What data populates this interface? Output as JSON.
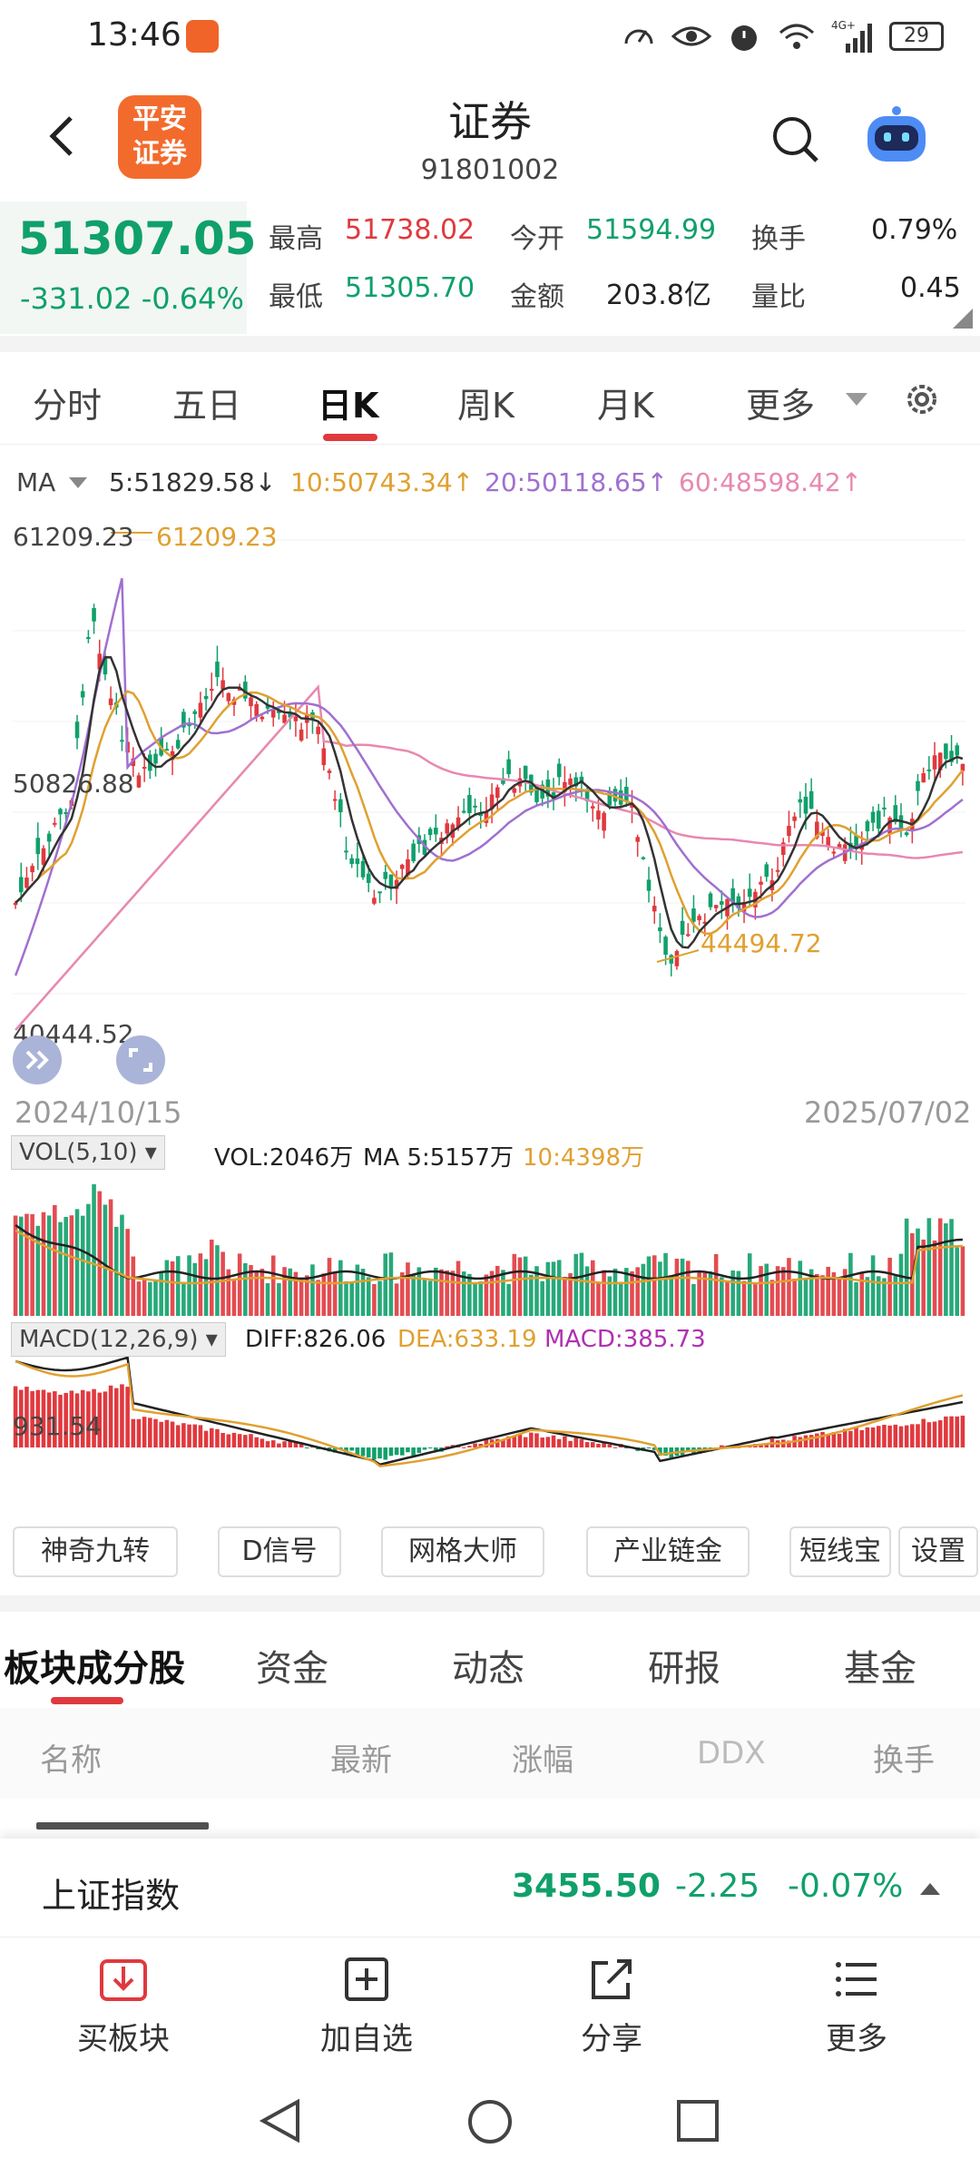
{
  "status_bar": {
    "time": "13:46",
    "battery": "29",
    "network": "4G+"
  },
  "header": {
    "brand_line1": "平安",
    "brand_line2": "证券",
    "title": "证券",
    "code": "91801002"
  },
  "quote": {
    "price": "51307.05",
    "change": "-331.02",
    "change_pct": "-0.64%",
    "high_label": "最高",
    "high": "51738.02",
    "low_label": "最低",
    "low": "51305.70",
    "open_label": "今开",
    "open": "51594.99",
    "amount_label": "金额",
    "amount": "203.8亿",
    "turnover_label": "换手",
    "turnover": "0.79%",
    "volume_ratio_label": "量比",
    "volume_ratio": "0.45"
  },
  "period_tabs": [
    {
      "label": "分时"
    },
    {
      "label": "五日"
    },
    {
      "label": "日K"
    },
    {
      "label": "周K"
    },
    {
      "label": "月K"
    },
    {
      "label": "更多"
    }
  ],
  "ma_legend": {
    "label": "MA",
    "items": [
      {
        "text": "5:51829.58↓",
        "color": "#333333"
      },
      {
        "text": "10:50743.34↑",
        "color": "#e0a030"
      },
      {
        "text": "20:50118.65↑",
        "color": "#a070d0"
      },
      {
        "text": "60:48598.42↑",
        "color": "#e888b0"
      }
    ]
  },
  "kline_labels": {
    "max_axis": "61209.23",
    "max_point": "61209.23",
    "mid_axis": "50826.88",
    "min_point": "44494.72",
    "min_axis": "40444.52",
    "start_date": "2024/10/15",
    "end_date": "2025/07/02"
  },
  "vol_legend": {
    "selector": "VOL(5,10)",
    "vol": "VOL:2046万",
    "ma5": "MA 5:5157万",
    "ma10": "10:4398万"
  },
  "macd_legend": {
    "selector": "MACD(12,26,9)",
    "diff": "DIFF:826.06",
    "dea": "DEA:633.19",
    "macd": "MACD:385.73",
    "axis": "931.54"
  },
  "tool_buttons": [
    {
      "label": "神奇九转"
    },
    {
      "label": "D信号"
    },
    {
      "label": "网格大师"
    },
    {
      "label": "产业链金"
    },
    {
      "label": "短线宝"
    },
    {
      "label": "设置"
    }
  ],
  "sub_tabs": [
    {
      "label": "板块成分股"
    },
    {
      "label": "资金"
    },
    {
      "label": "动态"
    },
    {
      "label": "研报"
    },
    {
      "label": "基金"
    }
  ],
  "table_header": {
    "name": "名称",
    "latest": "最新",
    "change": "涨幅",
    "ddx": "DDX",
    "turnover": "换手"
  },
  "index_bar": {
    "name": "上证指数",
    "price": "3455.50",
    "change": "-2.25",
    "change_pct": "-0.07%"
  },
  "bottom_nav": [
    {
      "label": "买板块"
    },
    {
      "label": "加自选"
    },
    {
      "label": "分享"
    },
    {
      "label": "更多"
    }
  ],
  "colors": {
    "up": "#e0393e",
    "down": "#10a06b",
    "accent": "#e0393e",
    "brand": "#f26b2d"
  }
}
